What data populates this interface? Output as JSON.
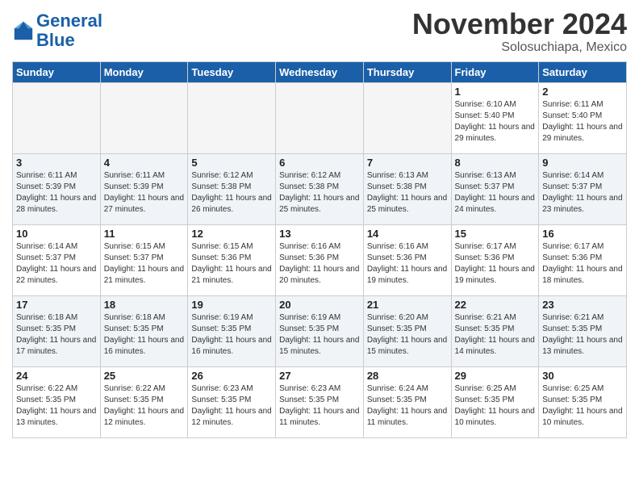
{
  "header": {
    "logo_line1": "General",
    "logo_line2": "Blue",
    "month_title": "November 2024",
    "location": "Solosuchiapa, Mexico"
  },
  "weekdays": [
    "Sunday",
    "Monday",
    "Tuesday",
    "Wednesday",
    "Thursday",
    "Friday",
    "Saturday"
  ],
  "weeks": [
    [
      {
        "day": "",
        "info": ""
      },
      {
        "day": "",
        "info": ""
      },
      {
        "day": "",
        "info": ""
      },
      {
        "day": "",
        "info": ""
      },
      {
        "day": "",
        "info": ""
      },
      {
        "day": "1",
        "info": "Sunrise: 6:10 AM\nSunset: 5:40 PM\nDaylight: 11 hours and 29 minutes."
      },
      {
        "day": "2",
        "info": "Sunrise: 6:11 AM\nSunset: 5:40 PM\nDaylight: 11 hours and 29 minutes."
      }
    ],
    [
      {
        "day": "3",
        "info": "Sunrise: 6:11 AM\nSunset: 5:39 PM\nDaylight: 11 hours and 28 minutes."
      },
      {
        "day": "4",
        "info": "Sunrise: 6:11 AM\nSunset: 5:39 PM\nDaylight: 11 hours and 27 minutes."
      },
      {
        "day": "5",
        "info": "Sunrise: 6:12 AM\nSunset: 5:38 PM\nDaylight: 11 hours and 26 minutes."
      },
      {
        "day": "6",
        "info": "Sunrise: 6:12 AM\nSunset: 5:38 PM\nDaylight: 11 hours and 25 minutes."
      },
      {
        "day": "7",
        "info": "Sunrise: 6:13 AM\nSunset: 5:38 PM\nDaylight: 11 hours and 25 minutes."
      },
      {
        "day": "8",
        "info": "Sunrise: 6:13 AM\nSunset: 5:37 PM\nDaylight: 11 hours and 24 minutes."
      },
      {
        "day": "9",
        "info": "Sunrise: 6:14 AM\nSunset: 5:37 PM\nDaylight: 11 hours and 23 minutes."
      }
    ],
    [
      {
        "day": "10",
        "info": "Sunrise: 6:14 AM\nSunset: 5:37 PM\nDaylight: 11 hours and 22 minutes."
      },
      {
        "day": "11",
        "info": "Sunrise: 6:15 AM\nSunset: 5:37 PM\nDaylight: 11 hours and 21 minutes."
      },
      {
        "day": "12",
        "info": "Sunrise: 6:15 AM\nSunset: 5:36 PM\nDaylight: 11 hours and 21 minutes."
      },
      {
        "day": "13",
        "info": "Sunrise: 6:16 AM\nSunset: 5:36 PM\nDaylight: 11 hours and 20 minutes."
      },
      {
        "day": "14",
        "info": "Sunrise: 6:16 AM\nSunset: 5:36 PM\nDaylight: 11 hours and 19 minutes."
      },
      {
        "day": "15",
        "info": "Sunrise: 6:17 AM\nSunset: 5:36 PM\nDaylight: 11 hours and 19 minutes."
      },
      {
        "day": "16",
        "info": "Sunrise: 6:17 AM\nSunset: 5:36 PM\nDaylight: 11 hours and 18 minutes."
      }
    ],
    [
      {
        "day": "17",
        "info": "Sunrise: 6:18 AM\nSunset: 5:35 PM\nDaylight: 11 hours and 17 minutes."
      },
      {
        "day": "18",
        "info": "Sunrise: 6:18 AM\nSunset: 5:35 PM\nDaylight: 11 hours and 16 minutes."
      },
      {
        "day": "19",
        "info": "Sunrise: 6:19 AM\nSunset: 5:35 PM\nDaylight: 11 hours and 16 minutes."
      },
      {
        "day": "20",
        "info": "Sunrise: 6:19 AM\nSunset: 5:35 PM\nDaylight: 11 hours and 15 minutes."
      },
      {
        "day": "21",
        "info": "Sunrise: 6:20 AM\nSunset: 5:35 PM\nDaylight: 11 hours and 15 minutes."
      },
      {
        "day": "22",
        "info": "Sunrise: 6:21 AM\nSunset: 5:35 PM\nDaylight: 11 hours and 14 minutes."
      },
      {
        "day": "23",
        "info": "Sunrise: 6:21 AM\nSunset: 5:35 PM\nDaylight: 11 hours and 13 minutes."
      }
    ],
    [
      {
        "day": "24",
        "info": "Sunrise: 6:22 AM\nSunset: 5:35 PM\nDaylight: 11 hours and 13 minutes."
      },
      {
        "day": "25",
        "info": "Sunrise: 6:22 AM\nSunset: 5:35 PM\nDaylight: 11 hours and 12 minutes."
      },
      {
        "day": "26",
        "info": "Sunrise: 6:23 AM\nSunset: 5:35 PM\nDaylight: 11 hours and 12 minutes."
      },
      {
        "day": "27",
        "info": "Sunrise: 6:23 AM\nSunset: 5:35 PM\nDaylight: 11 hours and 11 minutes."
      },
      {
        "day": "28",
        "info": "Sunrise: 6:24 AM\nSunset: 5:35 PM\nDaylight: 11 hours and 11 minutes."
      },
      {
        "day": "29",
        "info": "Sunrise: 6:25 AM\nSunset: 5:35 PM\nDaylight: 11 hours and 10 minutes."
      },
      {
        "day": "30",
        "info": "Sunrise: 6:25 AM\nSunset: 5:35 PM\nDaylight: 11 hours and 10 minutes."
      }
    ]
  ]
}
